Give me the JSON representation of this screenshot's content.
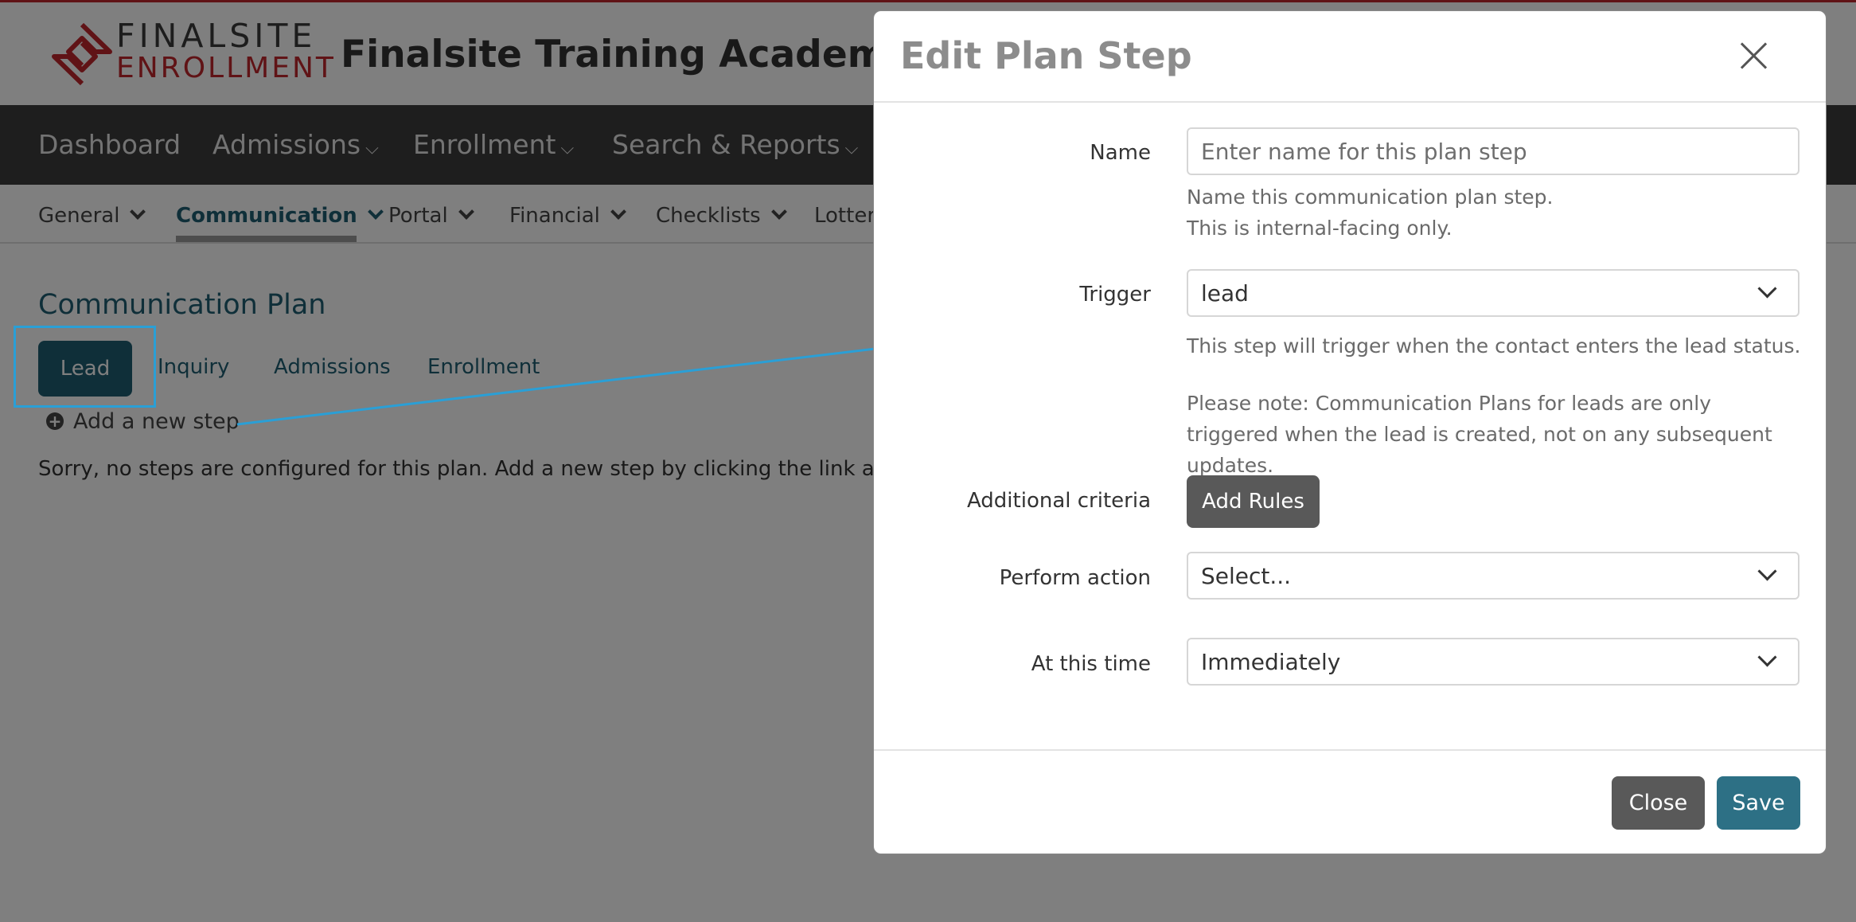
{
  "brand": {
    "logo_line1": "FINALSITE",
    "logo_line2": "ENROLLMENT",
    "site_title": "Finalsite Training Academy",
    "accent_red": "#c0262d",
    "accent_teal": "#1f5f73"
  },
  "main_nav": {
    "items": [
      {
        "label": "Dashboard",
        "has_dropdown": false
      },
      {
        "label": "Admissions",
        "has_dropdown": true
      },
      {
        "label": "Enrollment",
        "has_dropdown": true
      },
      {
        "label": "Search & Reports",
        "has_dropdown": true
      }
    ],
    "caret": "⌵"
  },
  "sub_nav": {
    "items": [
      "General",
      "Communication",
      "Portal",
      "Financial",
      "Checklists",
      "Lottery"
    ],
    "active": "Communication"
  },
  "page": {
    "title": "Communication Plan",
    "tabs": [
      "Lead",
      "Inquiry",
      "Admissions",
      "Enrollment"
    ],
    "active_tab": "Lead",
    "add_step_label": "Add a new step",
    "empty_message": "Sorry, no steps are configured for this plan. Add a new step by clicking the link above."
  },
  "modal": {
    "title": "Edit Plan Step",
    "name": {
      "label": "Name",
      "value": "",
      "placeholder": "Enter name for this plan step",
      "help_line1": "Name this communication plan step.",
      "help_line2": "This is internal-facing only."
    },
    "trigger": {
      "label": "Trigger",
      "value": "lead",
      "help": "This step will trigger when the contact enters the lead status.",
      "note": "Please note: Communication Plans for leads are only triggered when the lead is created, not on any subsequent updates."
    },
    "criteria": {
      "label": "Additional criteria",
      "button": "Add Rules"
    },
    "action": {
      "label": "Perform action",
      "value": "Select..."
    },
    "timing": {
      "label": "At this time",
      "value": "Immediately"
    },
    "close_button": "Close",
    "save_button": "Save"
  },
  "annotation_color": "#2a9fd6"
}
